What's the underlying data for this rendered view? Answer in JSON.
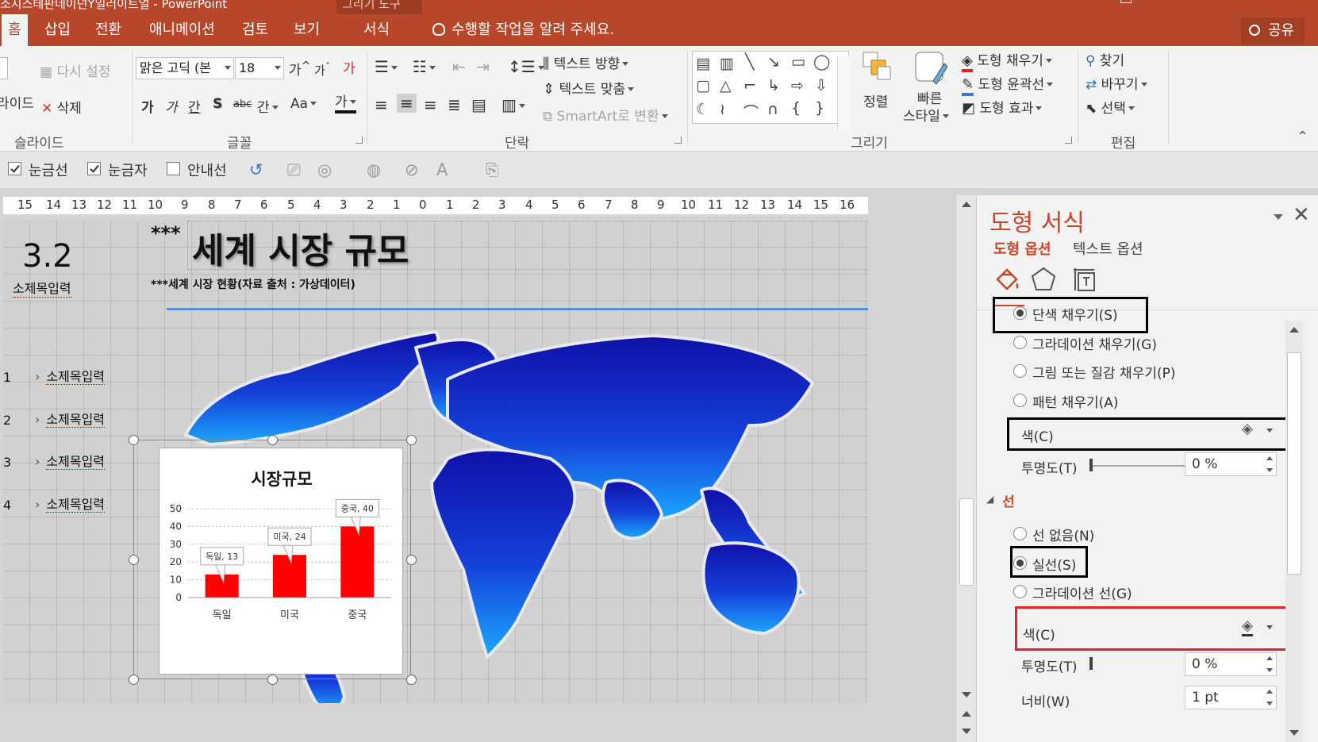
{
  "window": {
    "title": "소시스테판네이넌Y일러이트얼 - PowerPoint",
    "context_group": "그리기 도구"
  },
  "tabs": [
    {
      "label": "홈",
      "active": true
    },
    {
      "label": "삽입"
    },
    {
      "label": "전환"
    },
    {
      "label": "애니메이션"
    },
    {
      "label": "검토"
    },
    {
      "label": "보기"
    },
    {
      "label": "서식"
    }
  ],
  "tell_me": "수행할 작업을 알려 주세요.",
  "share": "공유",
  "ribbon": {
    "slides": {
      "reset": "다시 설정",
      "layout_partial": "라이드",
      "delete": "삭제",
      "label": "슬라이드"
    },
    "font": {
      "family": "맑은 고딕 (본",
      "size": "18",
      "grow": "가",
      "shrink": "가",
      "bold": "가",
      "italic": "가",
      "underline": "간",
      "shadow": "S",
      "strike": "abc",
      "spacing": "간",
      "case": "Aa",
      "color_a": "가",
      "label": "글꼴"
    },
    "paragraph": {
      "text_direction": "텍스트 방향",
      "align_text": "텍스트 맞춤",
      "smartart": "SmartArt로 변환",
      "label": "단락"
    },
    "drawing": {
      "arrange": "정렬",
      "quick_styles_1": "빠른",
      "quick_styles_2": "스타일",
      "fill": "도형 채우기",
      "outline": "도형 윤곽선",
      "effects": "도형 효과",
      "label": "그리기"
    },
    "editing": {
      "find": "찾기",
      "replace": "바꾸기",
      "select": "선택",
      "label": "편집"
    },
    "colors": {
      "tab_bar": "#b7472a",
      "accent": "#c8462a",
      "fill_red": "#e0242a"
    }
  },
  "view_options": {
    "gridlines": "눈금선",
    "ruler": "눈금자",
    "guides": "안내선",
    "gridlines_checked": true,
    "ruler_checked": true,
    "guides_checked": false
  },
  "ruler": {
    "ticks": [
      "15",
      "14",
      "13",
      "12",
      "11",
      "10",
      "9",
      "8",
      "7",
      "6",
      "5",
      "4",
      "3",
      "2",
      "1",
      "0",
      "1",
      "2",
      "3",
      "4",
      "5",
      "6",
      "7",
      "8",
      "9",
      "10",
      "11",
      "12",
      "13",
      "14",
      "15",
      "16"
    ]
  },
  "slide": {
    "section_number": "3.2",
    "section_caption": "소제목입력",
    "title_stars": "***",
    "title": "세계 시장 규모",
    "subtitle": "***세계 시장 현황(자료 출처 : 가상데이터)",
    "bullets": [
      {
        "num": "1",
        "text": "소제목입력"
      },
      {
        "num": "2",
        "text": "소제목입력"
      },
      {
        "num": "3",
        "text": "소제목입력"
      },
      {
        "num": "4",
        "text": "소제목입력"
      }
    ],
    "colors": {
      "map_top": "#1212b0",
      "map_bottom": "#1aa0ff",
      "accent_line": "#5b8dd6"
    }
  },
  "chart_data": {
    "type": "bar",
    "title": "시장규모",
    "categories": [
      "독일",
      "미국",
      "중국"
    ],
    "values": [
      13,
      24,
      40
    ],
    "data_labels": [
      "독일, 13",
      "미국, 24",
      "중국, 40"
    ],
    "ylim": [
      0,
      50
    ],
    "yticks": [
      "0",
      "10",
      "20",
      "30",
      "40",
      "50"
    ],
    "xlabel": "",
    "ylabel": "",
    "grid": true,
    "bar_color": "#ff0000"
  },
  "format_pane": {
    "title": "도형 서식",
    "tab_shape": "도형 옵션",
    "tab_text": "텍스트 옵션",
    "fill_options": [
      {
        "label": "단색 채우기(S)",
        "selected": true
      },
      {
        "label": "그라데이션 채우기(G)"
      },
      {
        "label": "그림 또는 질감 채우기(P)"
      },
      {
        "label": "패턴 채우기(A)"
      }
    ],
    "fill_color_label": "색(C)",
    "fill_transparency_label": "투명도(T)",
    "fill_transparency_value": "0 %",
    "line_section": "선",
    "line_options": [
      {
        "label": "선 없음(N)"
      },
      {
        "label": "실선(S)",
        "selected": true
      },
      {
        "label": "그라데이션 선(G)"
      }
    ],
    "line_color_label": "색(C)",
    "line_transparency_label": "투명도(T)",
    "line_transparency_value": "0 %",
    "width_label": "너비(W)",
    "width_value": "1 pt"
  }
}
